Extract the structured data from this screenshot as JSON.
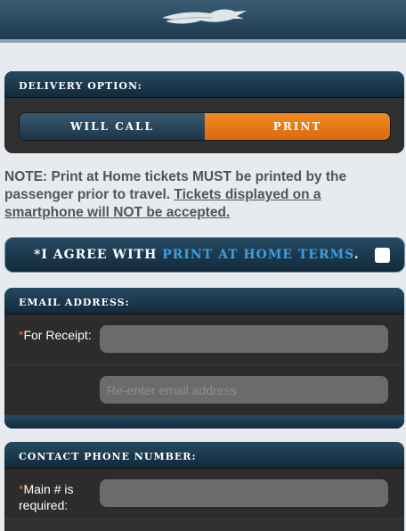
{
  "header": {
    "logo": "greyhound-logo"
  },
  "delivery": {
    "title": "DELIVERY OPTION:",
    "options": [
      "WILL CALL",
      "PRINT"
    ],
    "selected": "PRINT"
  },
  "note": {
    "text": "NOTE: Print at Home tickets MUST be printed by the passenger prior to travel. ",
    "underlined": "Tickets displayed on a smartphone will NOT be accepted."
  },
  "agree": {
    "prefix": "*I AGREE WITH ",
    "link": "PRINT AT HOME TERMS",
    "suffix": "."
  },
  "email": {
    "title": "EMAIL ADDRESS:",
    "label_required": "*",
    "label": "For Receipt:",
    "value": "",
    "confirm_placeholder": "Re-enter email address"
  },
  "phone": {
    "title": "CONTACT PHONE NUMBER:",
    "label_required": "*",
    "label": "Main # is required:"
  },
  "colors": {
    "accent_orange": "#e5781a",
    "header_navy": "#1e3a4e",
    "link_blue": "#3c9ee0"
  }
}
